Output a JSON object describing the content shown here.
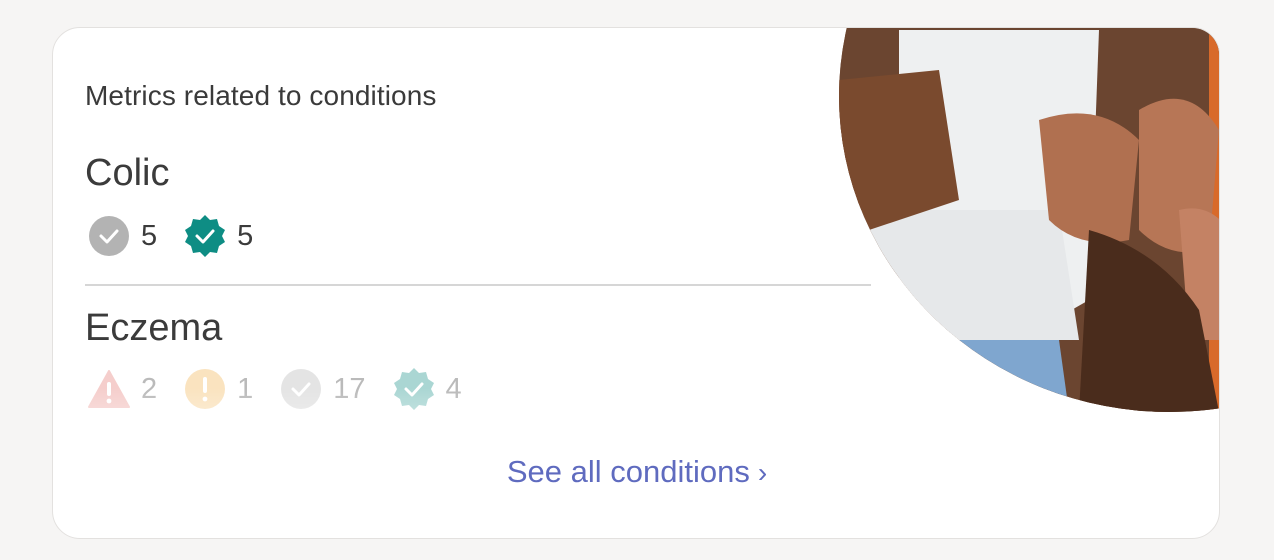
{
  "card": {
    "heading": "Metrics related to conditions",
    "conditions": [
      {
        "name": "Colic",
        "metrics": [
          {
            "icon": "check-circle-icon",
            "count": "5",
            "color": "#b3b3b3"
          },
          {
            "icon": "verified-badge-icon",
            "count": "5",
            "color": "#0e8d84"
          }
        ]
      },
      {
        "name": "Eczema",
        "metrics": [
          {
            "icon": "warning-triangle-icon",
            "count": "2",
            "color": "#e5756e"
          },
          {
            "icon": "alert-circle-icon",
            "count": "1",
            "color": "#f2b14b"
          },
          {
            "icon": "check-circle-icon",
            "count": "17",
            "color": "#b3b3b3"
          },
          {
            "icon": "verified-badge-icon",
            "count": "4",
            "color": "#0e8d84"
          }
        ]
      }
    ],
    "see_all_label": "See all conditions",
    "see_all_chevron": "›"
  },
  "colors": {
    "link": "#5f6bbf",
    "text": "#3b3b3b",
    "divider": "#d6d6d6"
  }
}
